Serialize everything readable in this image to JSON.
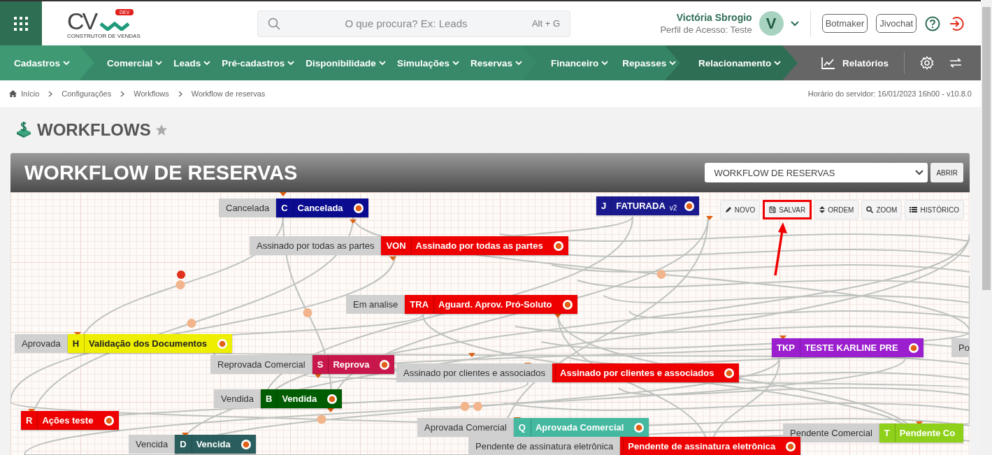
{
  "header": {
    "logo": {
      "text": "CV",
      "badge": "DEV",
      "tagline": "CONSTRUTOR DE VENDAS"
    },
    "search": {
      "placeholder": "O que procura? Ex: Leads",
      "shortcut": "Alt + G"
    },
    "user": {
      "name": "Victória Sbrogio",
      "profile": "Perfil de Acesso: Teste",
      "avatar": "V"
    },
    "buttons": [
      "Botmaker",
      "Jivochat"
    ]
  },
  "nav": [
    {
      "items": [
        "Cadastros"
      ]
    },
    {
      "items": [
        "Comercial",
        "Leads",
        "Pré-cadastros",
        "Disponibilidade",
        "Simulações",
        "Reservas"
      ]
    },
    {
      "items": [
        "Financeiro",
        "Repasses"
      ]
    },
    {
      "items": [
        "Relacionamento"
      ]
    }
  ],
  "reports": "Relatórios",
  "breadcrumb": [
    "Início",
    "Configurações",
    "Workflows",
    "Workflow de reservas"
  ],
  "server_time": "Horário do servidor: 16/01/2023 16h00 - v10.8.0",
  "page_title": "WORKFLOWS",
  "favorite": false,
  "panel": {
    "title": "WORKFLOW DE RESERVAS",
    "select_value": "WORKFLOW DE RESERVAS",
    "open_button": "ABRIR"
  },
  "toolbar": [
    {
      "kind": "new",
      "label": "NOVO",
      "highlighted": false
    },
    {
      "kind": "save",
      "label": "SALVAR",
      "highlighted": true
    },
    {
      "kind": "order",
      "label": "ORDEM",
      "highlighted": false
    },
    {
      "kind": "zoom",
      "label": "ZOOM",
      "highlighted": false
    },
    {
      "kind": "history",
      "label": "HISTÓRICO",
      "highlighted": false
    }
  ],
  "nodes": [
    {
      "label": "Cancelada",
      "code": "C",
      "title": "Cancelada",
      "color": "#0b0b8f"
    },
    {
      "label": "Assinado por todas as partes",
      "code": "VON",
      "title": "Assinado por todas as partes",
      "color": "#ee0000"
    },
    {
      "code": "J",
      "title": "FATURADA",
      "version": "v2",
      "color": "#1a1a8e"
    },
    {
      "label": "Em analise",
      "code": "TRA",
      "title": "Aguard. Aprov. Pró-Soluto",
      "color": "#ee0000"
    },
    {
      "label": "Aprovada",
      "code": "H",
      "title": "Validação dos Documentos",
      "color": "#eeee00"
    },
    {
      "label": "Reprovada Comercial",
      "code": "S",
      "title": "Reprova",
      "color": "#c8174a"
    },
    {
      "label": "Assinado por clientes e associados",
      "title": "Assinado por clientes e associados",
      "color": "#ee0000"
    },
    {
      "code": "TKP",
      "title": "TESTE KARLINE PRE",
      "color": "#9b1fcf"
    },
    {
      "label": "Po"
    },
    {
      "label": "Vendida",
      "code": "B",
      "title": "Vendida",
      "color": "#005c00"
    },
    {
      "code": "R",
      "title": "Ações teste",
      "color": "#ee0000"
    },
    {
      "label": "Aprovada Comercial",
      "code": "Q",
      "title": "Aprovada Comercial",
      "color": "#45b8a0"
    },
    {
      "label": "Pendente Comercial",
      "code": "T",
      "title": "Pendente Co",
      "color": "#8fd11a"
    },
    {
      "label": "Vencida",
      "code": "D",
      "title": "Vencida",
      "color": "#2a5e5e"
    },
    {
      "label": "Pendente de assinatura eletrônica",
      "title": "Pendente de assinatura eletrônica",
      "color": "#ee0000"
    }
  ]
}
